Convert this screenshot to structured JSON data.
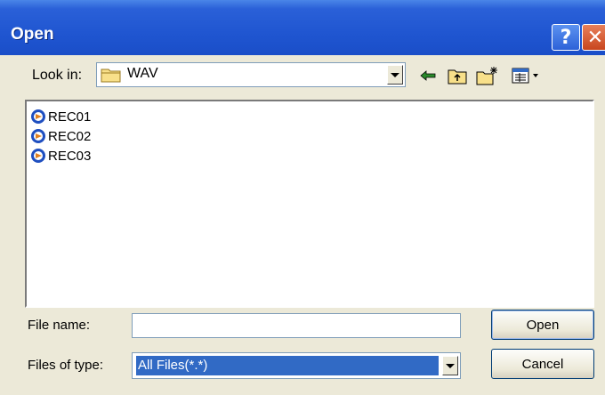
{
  "window": {
    "title": "Open",
    "help_icon": "question-mark-icon",
    "close_icon": "close-x-icon"
  },
  "lookin": {
    "label": "Look in:",
    "value": "WAV",
    "folder_icon": "folder-icon"
  },
  "toolbar": {
    "back_icon": "back-arrow-icon",
    "up_icon": "up-folder-icon",
    "new_folder_icon": "new-folder-icon",
    "view_icon": "view-menu-icon"
  },
  "files": [
    {
      "name": "REC01",
      "icon": "audio-file-icon"
    },
    {
      "name": "REC02",
      "icon": "audio-file-icon"
    },
    {
      "name": "REC03",
      "icon": "audio-file-icon"
    }
  ],
  "filename": {
    "label": "File name:",
    "value": ""
  },
  "filetype": {
    "label": "Files of type:",
    "value": "All Files(*.*)"
  },
  "buttons": {
    "open": "Open",
    "cancel": "Cancel"
  },
  "colors": {
    "titlebar": "#1f55d0",
    "dialog_bg": "#ece9d8",
    "selection": "#316ac5"
  }
}
